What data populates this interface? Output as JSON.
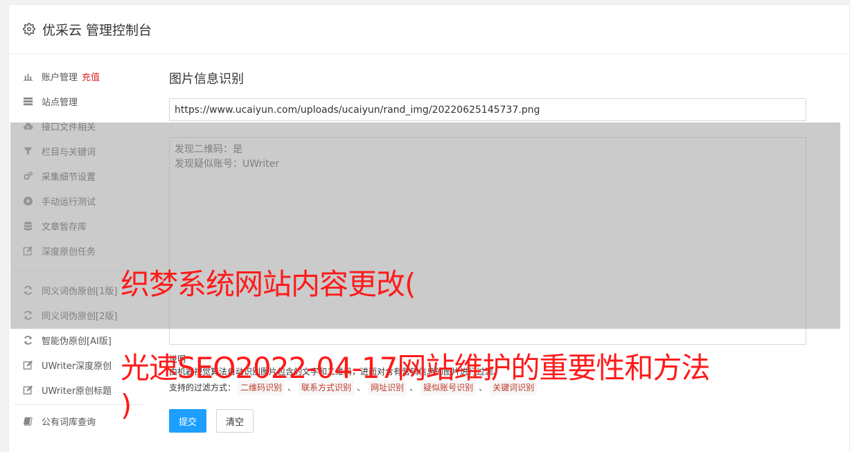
{
  "header": {
    "title": "优采云 管理控制台"
  },
  "sidebar": {
    "items": [
      {
        "label": "账户管理",
        "badge": "充值",
        "icon": "bar-chart-icon"
      },
      {
        "label": "站点管理",
        "icon": "server-icon"
      },
      {
        "label": "接口文件相关",
        "icon": "cloud-upload-icon"
      },
      {
        "label": "栏目与关键词",
        "icon": "filter-icon"
      },
      {
        "label": "采集细节设置",
        "icon": "gears-icon"
      },
      {
        "label": "手动运行测试",
        "icon": "play-icon"
      },
      {
        "label": "文章暂存库",
        "icon": "database-icon"
      },
      {
        "label": "深度原创任务",
        "icon": "edit-icon"
      },
      {
        "label": "同义词伪原创[1版]",
        "icon": "refresh-icon"
      },
      {
        "label": "同义词伪原创[2版]",
        "icon": "refresh-icon"
      },
      {
        "label": "智能伪原创[AI版]",
        "icon": "refresh-icon"
      },
      {
        "label": "UWriter深度原创",
        "icon": "edit-icon"
      },
      {
        "label": "UWriter原创标题",
        "icon": "edit-icon"
      },
      {
        "label": "公有词库查询",
        "icon": "book-icon"
      }
    ]
  },
  "main": {
    "title": "图片信息识别",
    "url_value": "https://www.ucaiyun.com/uploads/ucaiyun/rand_img/20220625145737.png",
    "result_lines": [
      "发现二维码：是",
      "发现疑似账号：UWriter"
    ],
    "desc_title": "说明",
    "desc_text": "由机器视觉算法自动识别图片包含的文字和二维码，进而对含有营销信息的图片进行过滤。",
    "filter_label": "支持的过滤方式：",
    "filters": [
      "二维码识别",
      "联系方式识别",
      "网址识别",
      "疑似账号识别",
      "关键词识别"
    ],
    "filter_sep": "、",
    "submit_label": "提交",
    "clear_label": "清空"
  },
  "watermark": {
    "line1": "织梦系统网站内容更改(",
    "line2": "光速SEO2022-04-17网站维护的重要性和方法",
    "line3": ")"
  },
  "colors": {
    "primary": "#1e9fff",
    "badge": "#e02020",
    "watermark": "#ff1a1a",
    "tag_text": "#c0392b"
  }
}
